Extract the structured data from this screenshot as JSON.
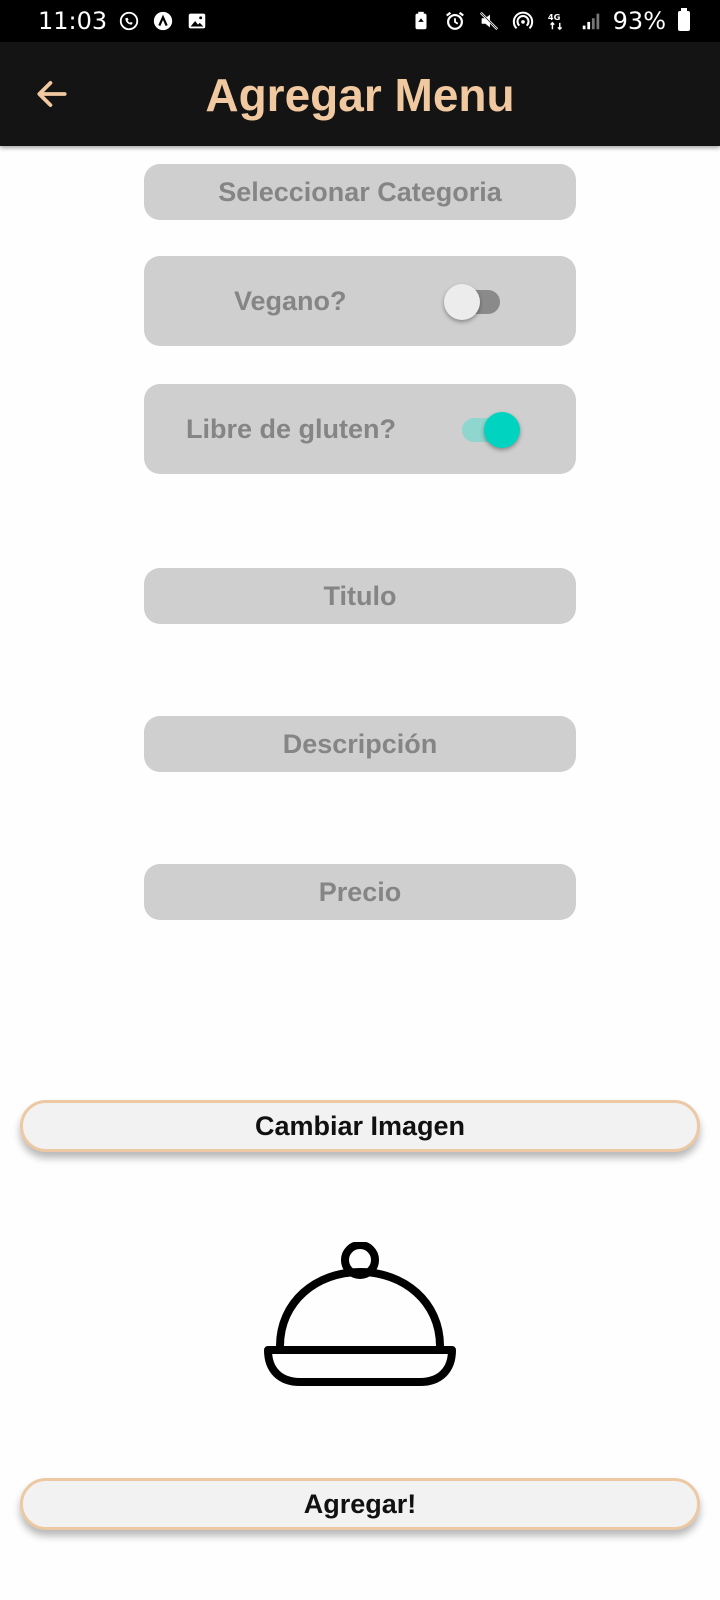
{
  "status_bar": {
    "time": "11:03",
    "left_icons": [
      "whatsapp-icon",
      "app-icon",
      "gallery-icon"
    ],
    "right_icons": [
      "battery-saver-icon",
      "alarm-icon",
      "mute-icon",
      "hotspot-icon",
      "4g-icon",
      "signal-icon"
    ],
    "battery_percent": "93%"
  },
  "app_bar": {
    "title": "Agregar Menu",
    "title_color": "#f0c9a0",
    "back_icon": "arrow-left-icon"
  },
  "form": {
    "category_placeholder": "Seleccionar Categoria",
    "vegan": {
      "label": "Vegano?",
      "on": false
    },
    "gluten_free": {
      "label": "Libre de gluten?",
      "on": true
    },
    "title_placeholder": "Titulo",
    "description_placeholder": "Descripción",
    "price_placeholder": "Precio"
  },
  "colors": {
    "accent": "#00d4c0",
    "accent_track": "#8fd6cf",
    "field_bg": "#cfcfcf",
    "button_border": "#edc9a3"
  },
  "actions": {
    "change_image_label": "Cambiar Imagen",
    "submit_label": "Agregar!"
  },
  "preview": {
    "icon": "food-cloche-icon"
  }
}
